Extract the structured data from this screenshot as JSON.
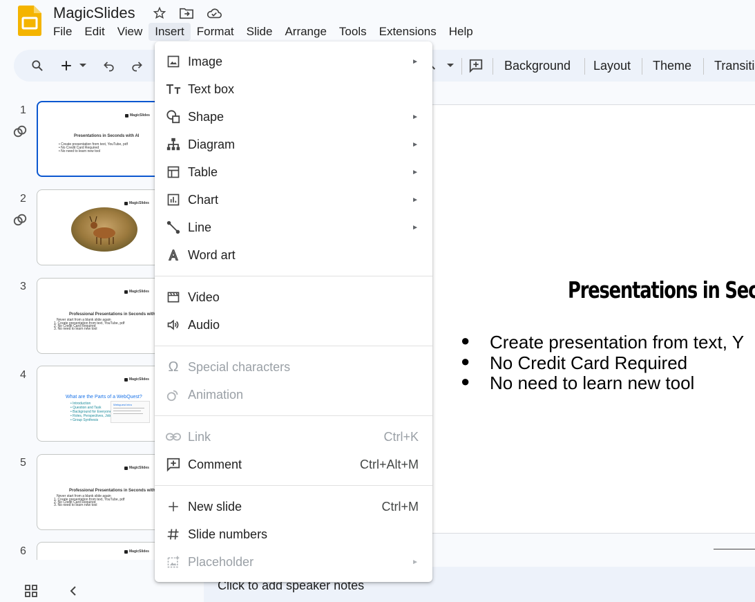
{
  "app": {
    "title": "MagicSlides",
    "menu": [
      "File",
      "Edit",
      "View",
      "Insert",
      "Format",
      "Slide",
      "Arrange",
      "Tools",
      "Extensions",
      "Help"
    ],
    "active_menu": "Insert"
  },
  "toolbar": {
    "background_label": "Background",
    "layout_label": "Layout",
    "theme_label": "Theme",
    "transition_label": "Transiti"
  },
  "filmstrip": {
    "slides": [
      {
        "num": "1",
        "brand": "MagicSlides",
        "title": "Presentations in Seconds with AI",
        "lines": [
          "Create presentation from text, YouTube, pdf",
          "No Credit Card Required",
          "No need to learn new tool"
        ]
      },
      {
        "num": "2",
        "brand": "MagicSlides"
      },
      {
        "num": "3",
        "brand": "MagicSlides",
        "title": "Professional Presentations in Seconds with AI",
        "lines": [
          "Never start from a blank slide again",
          "1. Create presentation from text, YouTube, pdf",
          "2. No Credit Card Required",
          "3. No need to learn new tool"
        ]
      },
      {
        "num": "4",
        "brand": "MagicSlides",
        "title": "What are the Parts of a WebQuest?",
        "lines": [
          "Introduction",
          "Question and Task",
          "Background for Everyone",
          "Roles, Perspectives, Jobs",
          "Group Synthesis"
        ],
        "side_title": "Webquest Intro"
      },
      {
        "num": "5",
        "brand": "MagicSlides",
        "title": "Professional Presentations in Seconds with AI",
        "lines": [
          "Never start from a blank slide again",
          "1. Create presentation from text, YouTube, pdf",
          "2. No Credit Card Required",
          "3. No need to learn new tool"
        ]
      },
      {
        "num": "6",
        "brand": "MagicSlides"
      }
    ]
  },
  "slide": {
    "title": "Presentations in Seco",
    "bullets": [
      "Create presentation from text, Y",
      "No Credit Card Required",
      "No need to learn new tool"
    ]
  },
  "notes": {
    "placeholder": "Click to add speaker notes"
  },
  "insert_menu": {
    "items": [
      {
        "label": "Image",
        "icon": "image-icon",
        "submenu": true
      },
      {
        "label": "Text box",
        "icon": "text-box-icon"
      },
      {
        "label": "Shape",
        "icon": "shape-icon",
        "submenu": true
      },
      {
        "label": "Diagram",
        "icon": "diagram-icon",
        "submenu": true
      },
      {
        "label": "Table",
        "icon": "table-icon",
        "submenu": true
      },
      {
        "label": "Chart",
        "icon": "chart-icon",
        "submenu": true
      },
      {
        "label": "Line",
        "icon": "line-icon",
        "submenu": true
      },
      {
        "label": "Word art",
        "icon": "word-art-icon"
      },
      {
        "label": "Video",
        "icon": "video-icon"
      },
      {
        "label": "Audio",
        "icon": "audio-icon"
      },
      {
        "label": "Special characters",
        "icon": "omega-icon",
        "disabled": true
      },
      {
        "label": "Animation",
        "icon": "animation-icon",
        "disabled": true
      },
      {
        "label": "Link",
        "icon": "link-icon",
        "shortcut": "Ctrl+K",
        "disabled": true
      },
      {
        "label": "Comment",
        "icon": "comment-icon",
        "shortcut": "Ctrl+Alt+M"
      },
      {
        "label": "New slide",
        "icon": "plus-icon",
        "shortcut": "Ctrl+M"
      },
      {
        "label": "Slide numbers",
        "icon": "hash-icon"
      },
      {
        "label": "Placeholder",
        "icon": "placeholder-icon",
        "submenu": true,
        "disabled": true
      }
    ]
  },
  "colors": {
    "accent": "#0b57d0",
    "logo": "#f4b400"
  }
}
